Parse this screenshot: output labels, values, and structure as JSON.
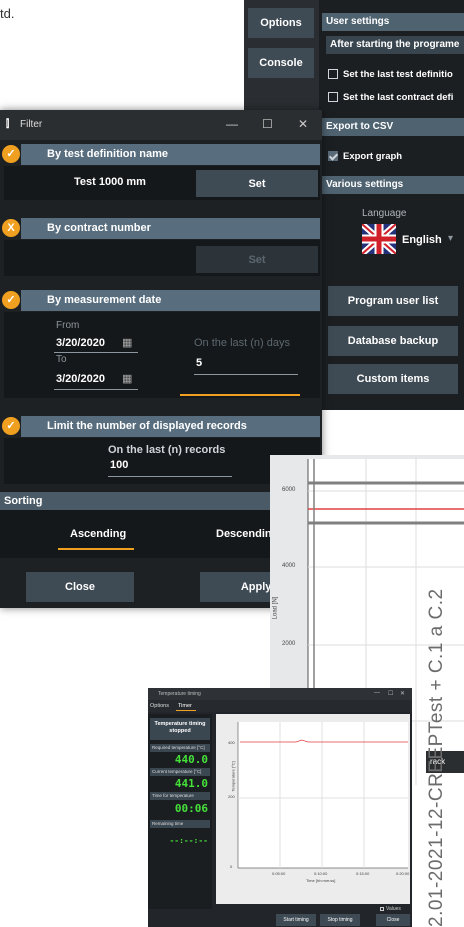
{
  "page_fragment": "td.",
  "options_window": {
    "side_tabs": [
      "Options",
      "Console"
    ],
    "user_settings": {
      "header": "User settings",
      "after_start_header": "After starting the programe",
      "checkboxes": [
        {
          "label": "Set the last test definitio",
          "checked": false
        },
        {
          "label": "Set the last contract defi",
          "checked": false
        }
      ]
    },
    "export": {
      "header": "Export to CSV",
      "checkbox": {
        "label": "Export graph",
        "checked": true
      }
    },
    "various": {
      "header": "Various settings",
      "language_label": "Language",
      "language_value": "English",
      "buttons": [
        "Program user list",
        "Database backup",
        "Custom items"
      ]
    }
  },
  "filter_window": {
    "title": "Filter",
    "controls": {
      "minimize": "—",
      "maximize": "☐",
      "close": "✕"
    },
    "sections": {
      "test_definition": {
        "header": "By test definition name",
        "badge": "✓",
        "value": "Test 1000 mm",
        "set_label": "Set"
      },
      "contract": {
        "header": "By contract number",
        "badge": "X",
        "set_label": "Set"
      },
      "date": {
        "header": "By measurement date",
        "badge": "✓",
        "from_label": "From",
        "from_value": "3/20/2020",
        "to_label": "To",
        "to_value": "3/20/2020",
        "last_days_label": "On the last (n) days",
        "last_days_value": "5"
      },
      "limit": {
        "header": "Limit the number of displayed records",
        "badge": "✓",
        "records_label": "On the last (n) records",
        "records_value": "100"
      },
      "sorting": {
        "header": "Sorting",
        "ascending": "Ascending",
        "descending": "Descending"
      }
    },
    "buttons": {
      "close": "Close",
      "apply": "Apply fi"
    }
  },
  "graph_window": {
    "ylabel": "Load [N]",
    "y_ticks": [
      "6000",
      "4000",
      "2000"
    ],
    "fragment_label": "rack",
    "series_colors": {
      "red": "#e04040",
      "gray": "#808080"
    }
  },
  "rotated_caption": "2.01-2021-12-CREEPTest + C.1 a C.2",
  "temperature_window": {
    "title": "Temperature timing",
    "controls": {
      "minimize": "—",
      "maximize": "☐",
      "close": "✕"
    },
    "tabs": [
      "Options",
      "Timer"
    ],
    "status": "Temperature timing stopped",
    "required_label": "Required temperature [°C]",
    "required_value": "440.0",
    "current_label": "Current temperature [°C]",
    "current_value": "441.0",
    "time_label": "Time for temperature",
    "time_value": "00:06",
    "remaining_label": "Remaining time",
    "remaining_value": "--:--:--",
    "chart_ylabel": "Temperature [°C]",
    "chart_xlabel": "Time [hh:mm:ss]",
    "chart_y_ticks": [
      "400",
      "200",
      "0"
    ],
    "chart_x_ticks": [
      "0:05:00",
      "0:10:00",
      "0:15:00",
      "0:20:00"
    ],
    "values_label": "Values",
    "buttons": [
      "Start timing",
      "Stop timing",
      "Close"
    ]
  }
}
